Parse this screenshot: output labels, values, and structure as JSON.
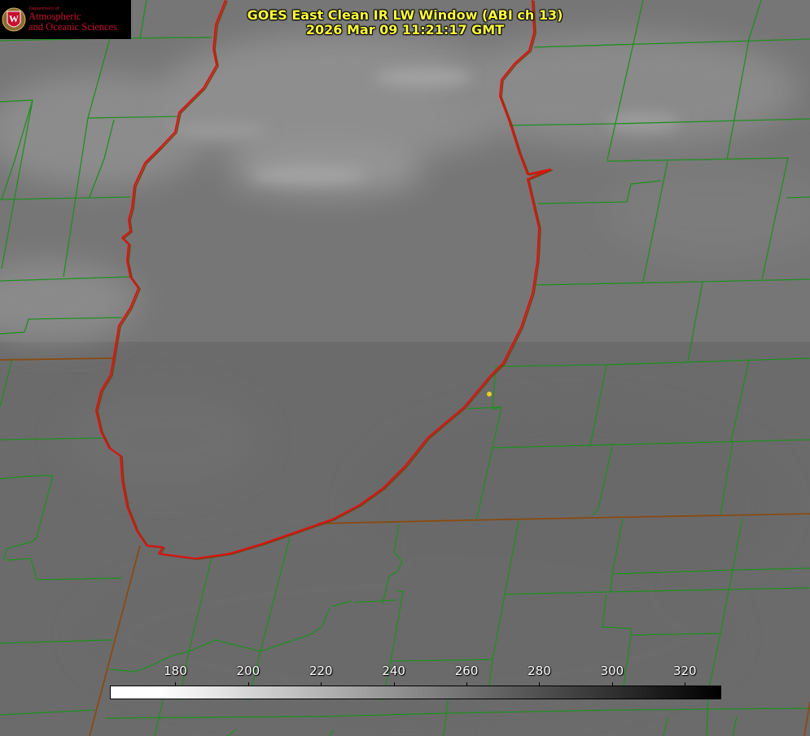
{
  "title": {
    "line1": "GOES East Clean IR LW Window (ABI ch 13)",
    "line2": "2026 Mar 09 11:21:17 GMT"
  },
  "logo": {
    "small": "Department of",
    "line1": "Atmospheric",
    "line2": "and Oceanic Sciences",
    "seal_letter": "W"
  },
  "colorbar": {
    "ticks": [
      {
        "label": "180",
        "value": 180
      },
      {
        "label": "200",
        "value": 200
      },
      {
        "label": "220",
        "value": 220
      },
      {
        "label": "240",
        "value": 240
      },
      {
        "label": "260",
        "value": 260
      },
      {
        "label": "280",
        "value": 280
      },
      {
        "label": "300",
        "value": 300
      },
      {
        "label": "320",
        "value": 320
      }
    ],
    "min": 162,
    "max": 330
  },
  "colors": {
    "county_lines": "#1f8f1f",
    "coastline": "#e01010",
    "state_lines": "#8a4a10",
    "title_text": "#ffff3a",
    "marker": "#e8d020",
    "logo_red": "#c8102e"
  }
}
